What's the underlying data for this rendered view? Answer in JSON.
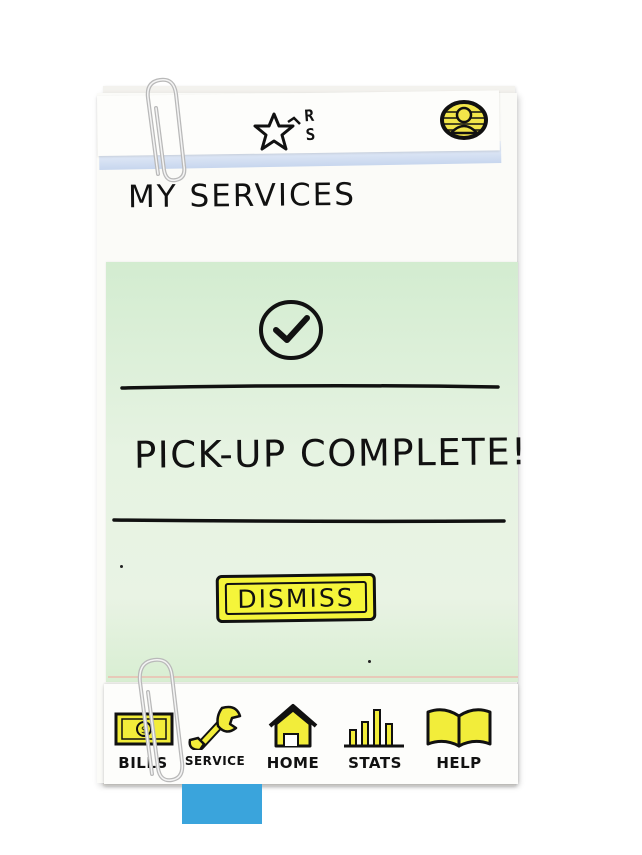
{
  "header": {
    "logo_letters": [
      "R",
      "S"
    ]
  },
  "page": {
    "title": "MY SERVICES"
  },
  "notification": {
    "message": "PICK-UP COMPLETE!",
    "dismiss_label": "DISMISS"
  },
  "nav": {
    "items": [
      {
        "label": "BILLS",
        "icon": "bills-icon"
      },
      {
        "label": "SERVICE",
        "icon": "wrench-icon"
      },
      {
        "label": "HOME",
        "icon": "house-icon"
      },
      {
        "label": "STATS",
        "icon": "bar-chart-icon"
      },
      {
        "label": "HELP",
        "icon": "book-icon"
      }
    ]
  },
  "colors": {
    "highlight": "#f5f53a",
    "panel_green": "#dcefd8",
    "header_blue": "#c7d6ee",
    "ink": "#111111",
    "tab_blue": "#3aa4dc"
  }
}
